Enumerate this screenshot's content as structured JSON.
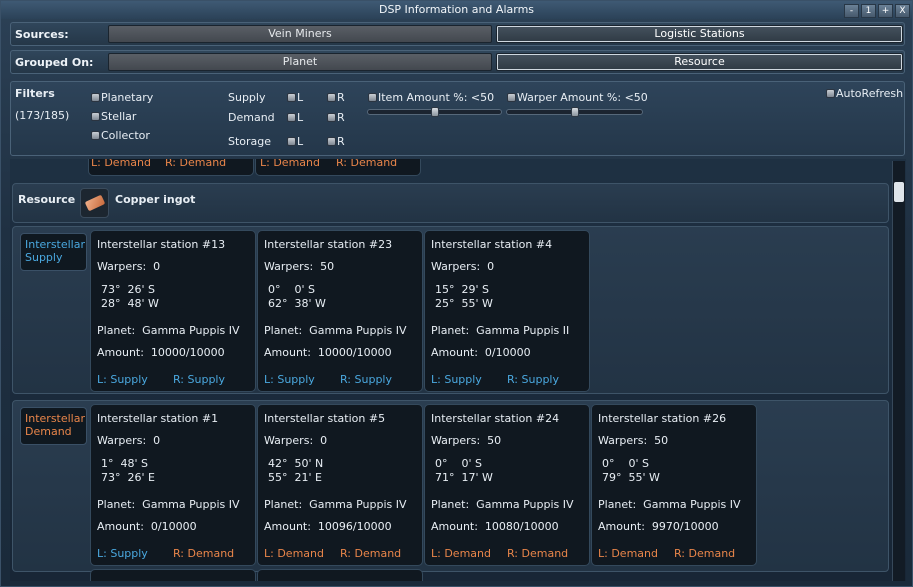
{
  "window": {
    "title": "DSP Information and Alarms",
    "buttons": [
      "-",
      "1",
      "+",
      "X"
    ]
  },
  "sources": {
    "label": "Sources:",
    "options": [
      "Vein Miners",
      "Logistic Stations"
    ],
    "selected": "Logistic Stations"
  },
  "grouped": {
    "label": "Grouped On:",
    "options": [
      "Planet",
      "Resource"
    ],
    "selected": "Resource"
  },
  "filters": {
    "label": "Filters",
    "count": "(173/185)",
    "types": [
      "Planetary",
      "Stellar",
      "Collector"
    ],
    "modes": [
      "Supply",
      "Demand",
      "Storage"
    ],
    "l": "L",
    "r": "R",
    "item_amount": "Item Amount %: <50",
    "warper_amount": "Warper Amount %: <50",
    "item_amount_level": 0.5,
    "warper_amount_level": 0.5,
    "autorefresh": "AutoRefresh"
  },
  "resource": {
    "label": "Resource",
    "name": "Copper ingot",
    "icon": "copper-ingot-icon"
  },
  "partial_top": [
    {
      "l": "L: Demand",
      "r": "R: Demand"
    },
    {
      "l": "L: Demand",
      "r": "R: Demand"
    }
  ],
  "groups": [
    {
      "label": "Interstellar Supply",
      "kind": "supply",
      "stations": [
        {
          "title": "Interstellar station #13",
          "warpers": "Warpers:  0",
          "coord1": "73°  26' S",
          "coord2": "28°  48' W",
          "planet": "Planet:  Gamma Puppis IV",
          "amount": "Amount:  10000/10000",
          "l": "L: Supply",
          "r": "R: Supply",
          "lk": "supply",
          "rk": "supply"
        },
        {
          "title": "Interstellar station #23",
          "warpers": "Warpers:  50",
          "coord1": "0°    0' S",
          "coord2": "62°  38' W",
          "planet": "Planet:  Gamma Puppis IV",
          "amount": "Amount:  10000/10000",
          "l": "L: Supply",
          "r": "R: Supply",
          "lk": "supply",
          "rk": "supply"
        },
        {
          "title": "Interstellar station #4",
          "warpers": "Warpers:  0",
          "coord1": "15°  29' S",
          "coord2": "25°  55' W",
          "planet": "Planet:  Gamma Puppis II",
          "amount": "Amount:  0/10000",
          "l": "L: Supply",
          "r": "R: Supply",
          "lk": "supply",
          "rk": "supply"
        }
      ]
    },
    {
      "label": "Interstellar Demand",
      "kind": "demand",
      "stations": [
        {
          "title": "Interstellar station #1",
          "warpers": "Warpers:  0",
          "coord1": "1°  48' S",
          "coord2": "73°  26' E",
          "planet": "Planet:  Gamma Puppis IV",
          "amount": "Amount:  0/10000",
          "l": "L: Supply",
          "r": "R: Demand",
          "lk": "supply",
          "rk": "demand"
        },
        {
          "title": "Interstellar station #5",
          "warpers": "Warpers:  0",
          "coord1": "42°  50' N",
          "coord2": "55°  21' E",
          "planet": "Planet:  Gamma Puppis IV",
          "amount": "Amount:  10096/10000",
          "l": "L: Demand",
          "r": "R: Demand",
          "lk": "demand",
          "rk": "demand"
        },
        {
          "title": "Interstellar station #24",
          "warpers": "Warpers:  50",
          "coord1": "0°    0' S",
          "coord2": "71°  17' W",
          "planet": "Planet:  Gamma Puppis IV",
          "amount": "Amount:  10080/10000",
          "l": "L: Demand",
          "r": "R: Demand",
          "lk": "demand",
          "rk": "demand"
        },
        {
          "title": "Interstellar station #26",
          "warpers": "Warpers:  50",
          "coord1": "0°    0' S",
          "coord2": "79°  55' W",
          "planet": "Planet:  Gamma Puppis IV",
          "amount": "Amount:  9970/10000",
          "l": "L: Demand",
          "r": "R: Demand",
          "lk": "demand",
          "rk": "demand"
        }
      ]
    }
  ],
  "colors": {
    "supply": "#4aa8df",
    "demand": "#e8854a",
    "copper": "#d98a5c"
  }
}
